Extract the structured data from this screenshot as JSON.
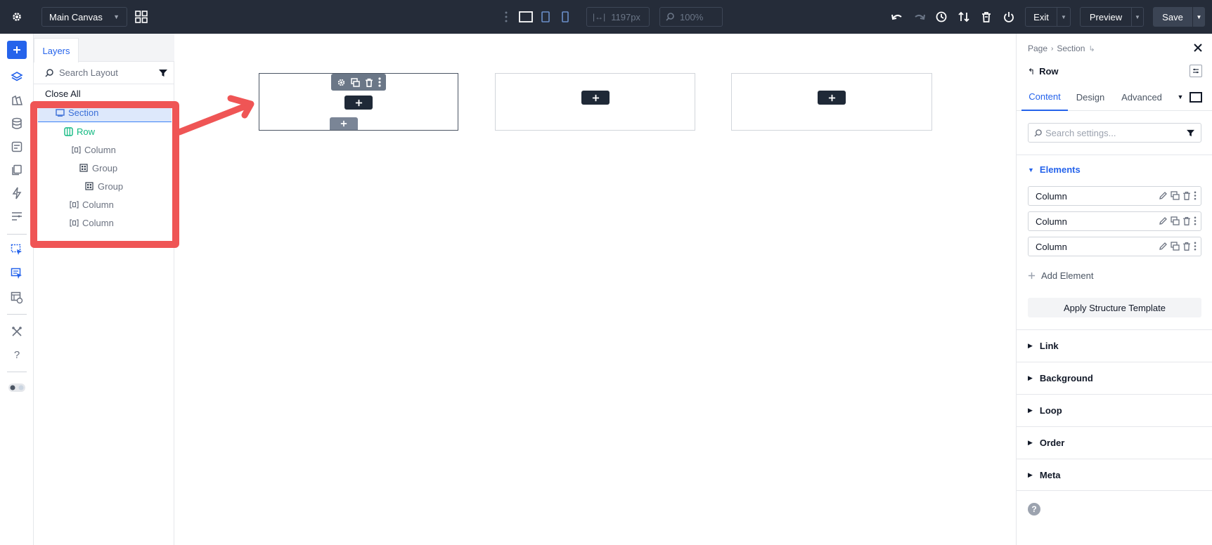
{
  "topbar": {
    "canvas_select": "Main Canvas",
    "width_value": "1197px",
    "zoom_value": "100%",
    "exit_label": "Exit",
    "preview_label": "Preview",
    "save_label": "Save"
  },
  "layers": {
    "tab_label": "Layers",
    "search_placeholder": "Search Layout",
    "close_all_label": "Close All",
    "tree": [
      {
        "label": "Section"
      },
      {
        "label": "Row"
      },
      {
        "label": "Column"
      },
      {
        "label": "Group"
      },
      {
        "label": "Group"
      },
      {
        "label": "Column"
      },
      {
        "label": "Column"
      }
    ]
  },
  "panel": {
    "breadcrumb": [
      "Page",
      "Section"
    ],
    "title": "Row",
    "tabs": [
      "Content",
      "Design",
      "Advanced"
    ],
    "search_placeholder": "Search settings...",
    "elements_heading": "Elements",
    "elements": [
      {
        "label": "Column"
      },
      {
        "label": "Column"
      },
      {
        "label": "Column"
      }
    ],
    "add_element_label": "Add Element",
    "apply_template_label": "Apply Structure Template",
    "accordions": [
      "Link",
      "Background",
      "Loop",
      "Order",
      "Meta"
    ]
  },
  "colors": {
    "accent": "#2563eb",
    "topbar_bg": "#252c39",
    "highlight": "#ef5555",
    "row_green": "#10b981"
  }
}
